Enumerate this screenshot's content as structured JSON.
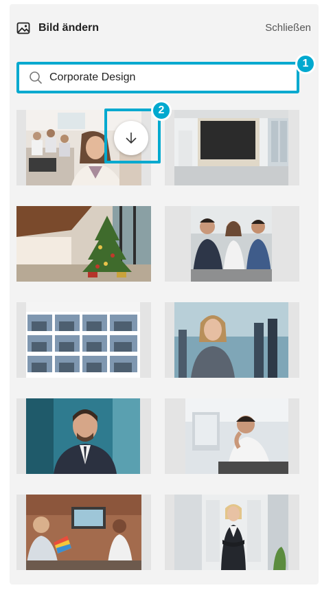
{
  "header": {
    "title": "Bild ändern",
    "close_label": "Schließen",
    "title_icon": "image-icon"
  },
  "search": {
    "value": "Corporate Design",
    "icon": "search-icon"
  },
  "badges": [
    "1",
    "2"
  ],
  "download_icon": "arrow-down-icon",
  "accent_color": "#00a9cf",
  "images": [
    {
      "name": "office-woman-smiling"
    },
    {
      "name": "empty-office-screen"
    },
    {
      "name": "lobby-christmas-tree"
    },
    {
      "name": "business-meeting"
    },
    {
      "name": "building-search-results"
    },
    {
      "name": "businesswoman-portrait"
    },
    {
      "name": "businessman-portrait"
    },
    {
      "name": "stressed-worker-headset"
    },
    {
      "name": "color-swatch-meeting"
    },
    {
      "name": "woman-office-hallway"
    }
  ]
}
